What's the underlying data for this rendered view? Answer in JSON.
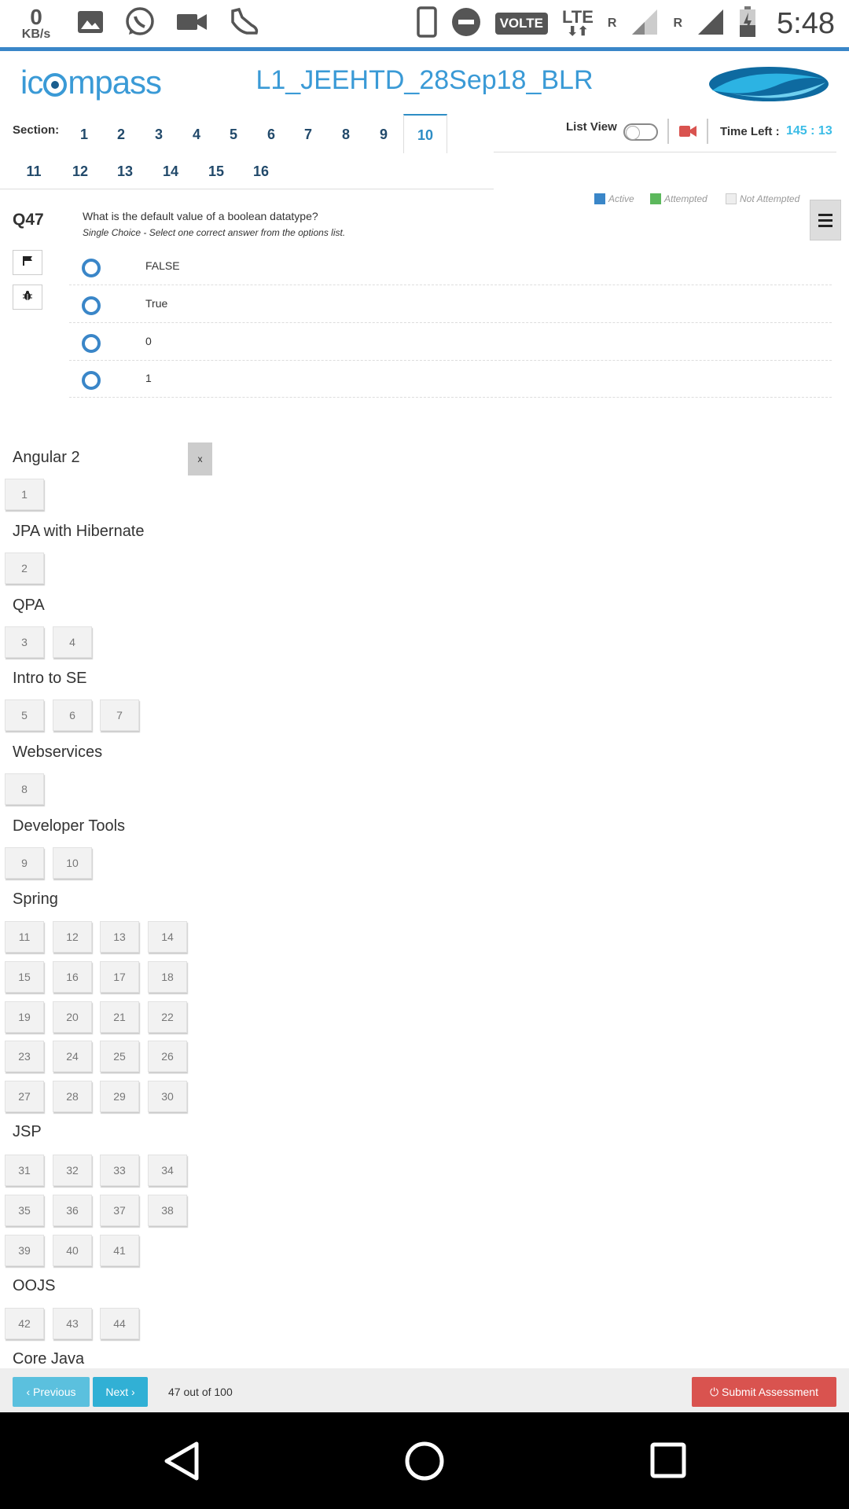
{
  "status_bar": {
    "net_speed_value": "0",
    "net_speed_unit": "KB/s",
    "volte": "VOLTE",
    "lte": "LTE",
    "roaming_1": "R",
    "roaming_2": "R",
    "time": "5:48"
  },
  "header": {
    "logo_prefix": "ic",
    "logo_suffix": "mpass",
    "title": "L1_JEEHTD_28Sep18_BLR"
  },
  "sections": {
    "label": "Section:",
    "items": [
      "1",
      "2",
      "3",
      "4",
      "5",
      "6",
      "7",
      "8",
      "9",
      "10",
      "11",
      "12",
      "13",
      "14",
      "15",
      "16"
    ],
    "active": "10"
  },
  "tools": {
    "list_view_label": "List View",
    "time_left_label": "Time Left :",
    "time_left_value": "145 : 13"
  },
  "legend": {
    "active": "Active",
    "attempted": "Attempted",
    "not_attempted": "Not Attempted",
    "active_color": "#3a86c8",
    "attempted_color": "#5cb85c",
    "not_attempted_color": "#eeeeee"
  },
  "question": {
    "number": "Q47",
    "text": "What is the default value of a boolean datatype?",
    "hint": "Single Choice - Select one correct answer from the options list.",
    "options": [
      "FALSE",
      "True",
      "0",
      "1"
    ]
  },
  "palette": {
    "close_label": "x",
    "groups": [
      {
        "title": "Angular 2",
        "questions": [
          "1"
        ]
      },
      {
        "title": "JPA with Hibernate",
        "questions": [
          "2"
        ]
      },
      {
        "title": "QPA",
        "questions": [
          "3",
          "4"
        ]
      },
      {
        "title": "Intro to SE",
        "questions": [
          "5",
          "6",
          "7"
        ]
      },
      {
        "title": "Webservices",
        "questions": [
          "8"
        ]
      },
      {
        "title": "Developer Tools",
        "questions": [
          "9",
          "10"
        ]
      },
      {
        "title": "Spring",
        "questions": [
          "11",
          "12",
          "13",
          "14",
          "15",
          "16",
          "17",
          "18",
          "19",
          "20",
          "21",
          "22",
          "23",
          "24",
          "25",
          "26",
          "27",
          "28",
          "29",
          "30"
        ]
      },
      {
        "title": "JSP",
        "questions": [
          "31",
          "32",
          "33",
          "34",
          "35",
          "36",
          "37",
          "38",
          "39",
          "40",
          "41"
        ]
      },
      {
        "title": "OOJS",
        "questions": [
          "42",
          "43",
          "44"
        ]
      },
      {
        "title": "Core Java",
        "questions": []
      }
    ]
  },
  "footer": {
    "previous_label": "‹ Previous",
    "next_label": "Next ›",
    "progress_text": "47 out of 100",
    "submit_label": "Submit Assessment"
  }
}
